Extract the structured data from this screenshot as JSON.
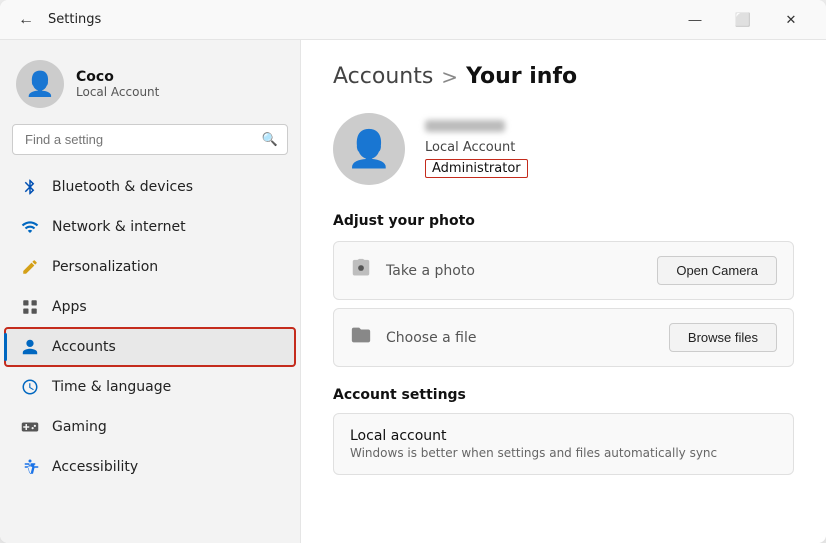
{
  "window": {
    "title": "Settings",
    "back_label": "←",
    "controls": {
      "minimize": "—",
      "maximize": "⬜",
      "close": "✕"
    }
  },
  "sidebar": {
    "user": {
      "name": "Coco",
      "type": "Local Account",
      "avatar_icon": "👤"
    },
    "search": {
      "placeholder": "Find a setting",
      "icon": "🔍"
    },
    "nav_items": [
      {
        "id": "bluetooth",
        "label": "Bluetooth & devices",
        "icon": "bluetooth",
        "active": false,
        "highlighted": false
      },
      {
        "id": "network",
        "label": "Network & internet",
        "icon": "network",
        "active": false,
        "highlighted": false
      },
      {
        "id": "personalization",
        "label": "Personalization",
        "icon": "pencil",
        "active": false,
        "highlighted": false
      },
      {
        "id": "apps",
        "label": "Apps",
        "icon": "apps",
        "active": false,
        "highlighted": false
      },
      {
        "id": "accounts",
        "label": "Accounts",
        "icon": "accounts",
        "active": true,
        "highlighted": true
      },
      {
        "id": "time",
        "label": "Time & language",
        "icon": "time",
        "active": false,
        "highlighted": false
      },
      {
        "id": "gaming",
        "label": "Gaming",
        "icon": "gaming",
        "active": false,
        "highlighted": false
      },
      {
        "id": "accessibility",
        "label": "Accessibility",
        "icon": "accessibility",
        "active": false,
        "highlighted": false
      }
    ]
  },
  "main": {
    "breadcrumb_accounts": "Accounts",
    "breadcrumb_sep": ">",
    "breadcrumb_current": "Your info",
    "profile": {
      "avatar_icon": "👤",
      "account_type": "Local Account",
      "role": "Administrator",
      "role_highlighted": true
    },
    "adjust_photo_title": "Adjust your photo",
    "photo_actions": [
      {
        "id": "take-photo",
        "icon": "📷",
        "label": "Take a photo",
        "button": "Open Camera"
      },
      {
        "id": "choose-file",
        "icon": "📁",
        "label": "Choose a file",
        "button": "Browse files"
      }
    ],
    "account_settings_title": "Account settings",
    "local_account": {
      "title": "Local account",
      "description": "Windows is better when settings and files automatically sync"
    }
  }
}
